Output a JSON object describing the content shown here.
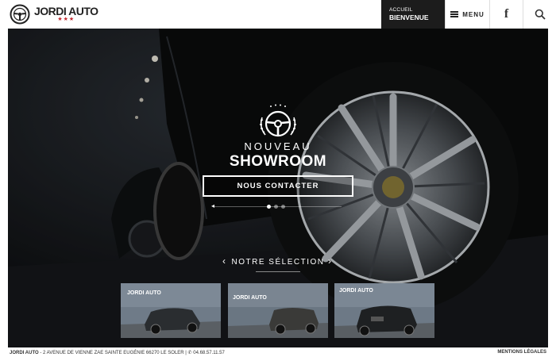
{
  "header": {
    "logo_name": "JORDI AUTO",
    "logo_stars": "★★★",
    "nav_accueil_small": "ACCUEIL",
    "nav_accueil_main": "BIENVENUE",
    "menu_label": "MENU",
    "facebook_glyph": "f",
    "icons": [
      "steering-wheel-icon",
      "hamburger-icon",
      "facebook-icon",
      "search-icon"
    ]
  },
  "hero": {
    "subtitle": "NOUVEAU",
    "title": "SHOWROOM",
    "cta_label": "NOUS CONTACTER",
    "slider_arrow": "◂",
    "slides_count": 3,
    "active_slide": 1
  },
  "selection": {
    "title": "NOTRE SÉLECTION",
    "prev_glyph": "‹",
    "next_glyph": "›",
    "thumbnails": [
      {
        "label": "JORDI AUTO",
        "color": "#2a2d30"
      },
      {
        "label": "JORDI AUTO",
        "color": "#3a3a38"
      },
      {
        "label": "JORDI AUTO",
        "color": "#1e2022"
      }
    ]
  },
  "footer": {
    "brand": "JORDI AUTO",
    "address": " - 2 AVENUE DE VIENNE ZAE SAINTE EUGÉNIE 66270 LE SOLER | ",
    "phone": "✆ 04.68.57.11.57",
    "legal": "MENTIONS LÉGALES"
  },
  "colors": {
    "accent_red": "#c0262d",
    "dark": "#1c1c1c",
    "hero_bg": "#121416"
  }
}
